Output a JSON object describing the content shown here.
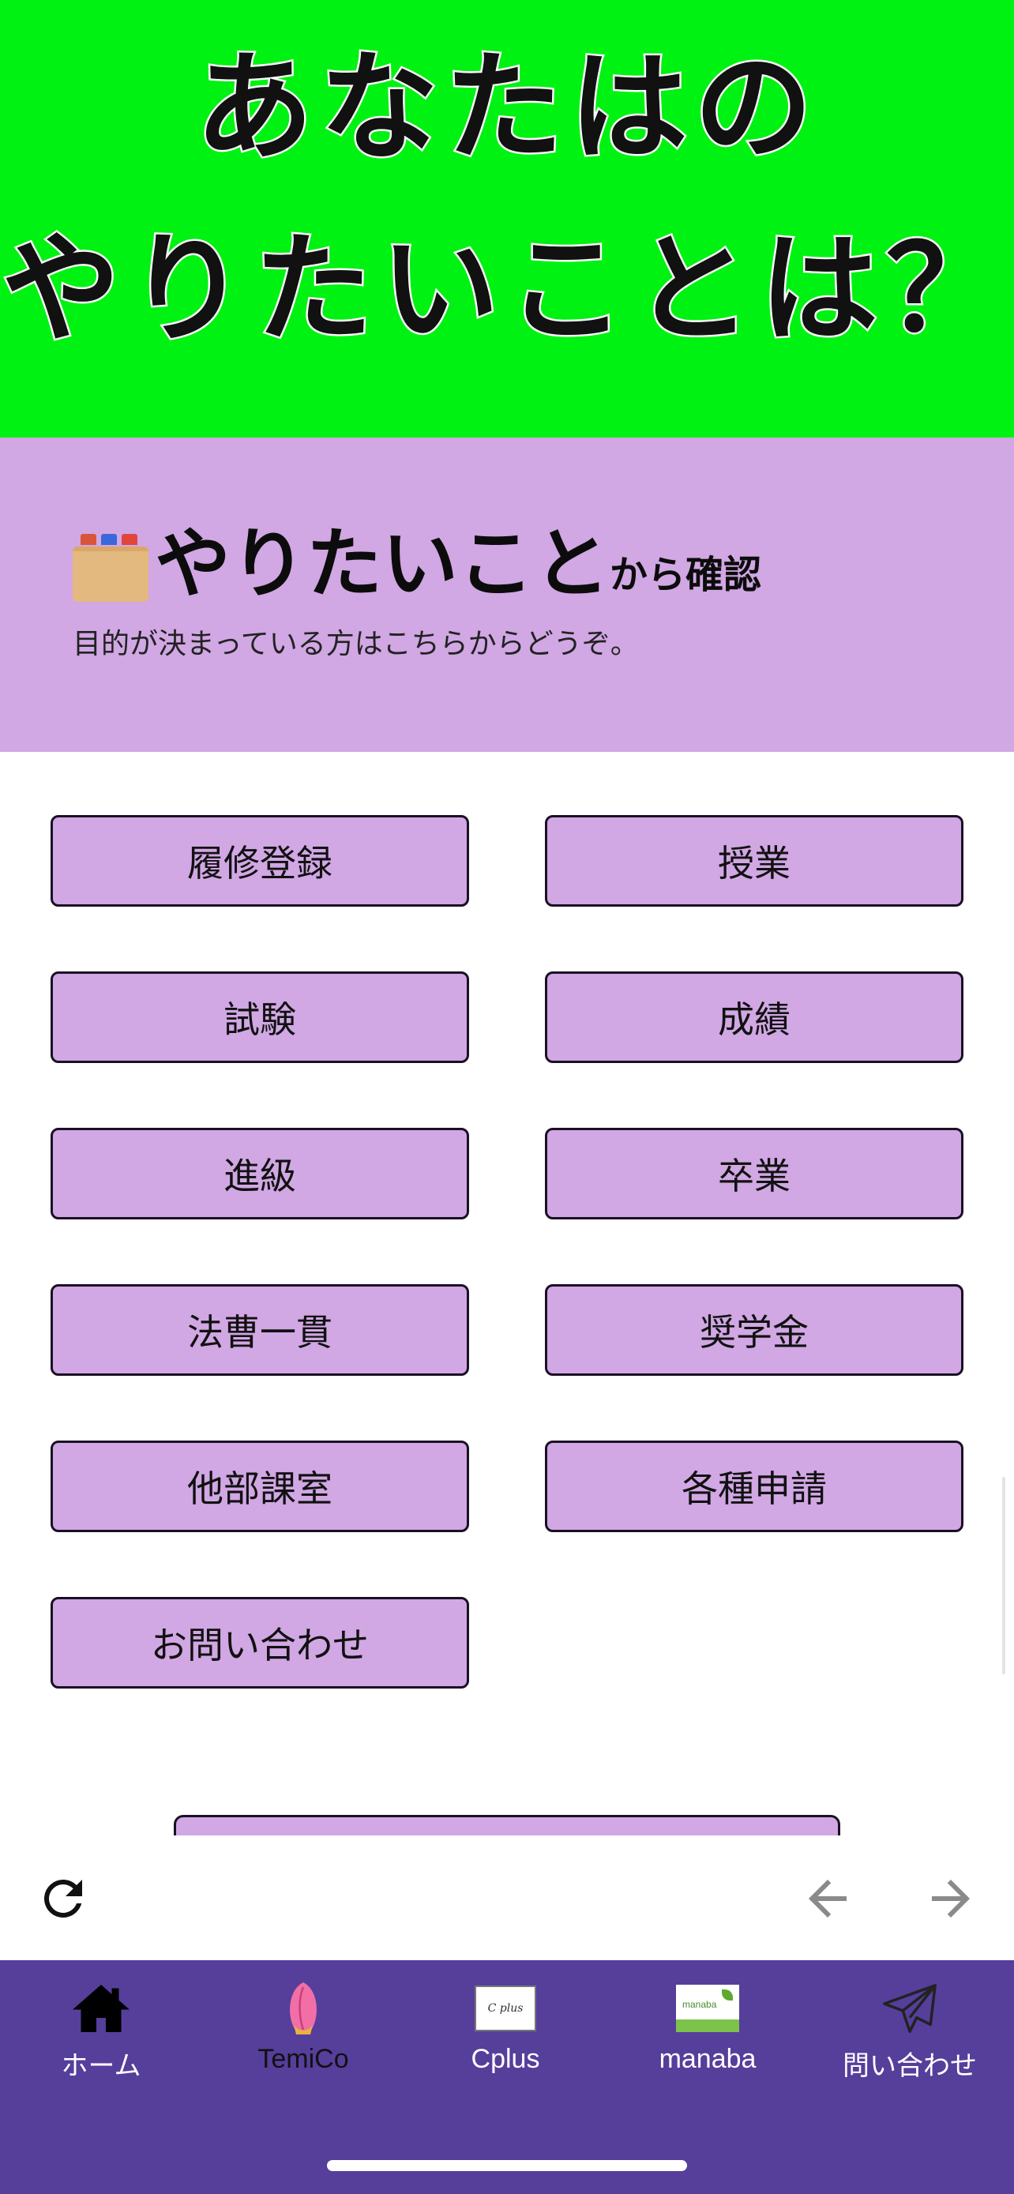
{
  "hero": {
    "line1": "あなたはの",
    "line2": "やりたいことは？",
    "background": "#00f212"
  },
  "section": {
    "icon": "card-file-box-icon",
    "title_big": "やりたいこと",
    "title_small": "から確認",
    "description": "目的が決まっている方はこちらからどうぞ。",
    "background": "#d1a7e4"
  },
  "buttons": [
    "履修登録",
    "授業",
    "試験",
    "成績",
    "進級",
    "卒業",
    "法曹一貫",
    "奨学金",
    "他部課室",
    "各種申請",
    "お問い合わせ"
  ],
  "browser_bar": {
    "reload_icon": "reload-icon",
    "back_icon": "arrow-left-icon",
    "forward_icon": "arrow-right-icon"
  },
  "tab_bar": {
    "background": "#563e9b",
    "items": [
      {
        "label": "ホーム",
        "icon": "home-icon"
      },
      {
        "label": "TemiCo",
        "icon": "flower-bud-icon"
      },
      {
        "label": "Cplus",
        "icon": "cplus-logo-icon",
        "logo_text": "C plus"
      },
      {
        "label": "manaba",
        "icon": "manaba-logo-icon",
        "logo_text": "manaba"
      },
      {
        "label": "問い合わせ",
        "icon": "paper-plane-icon"
      }
    ]
  }
}
